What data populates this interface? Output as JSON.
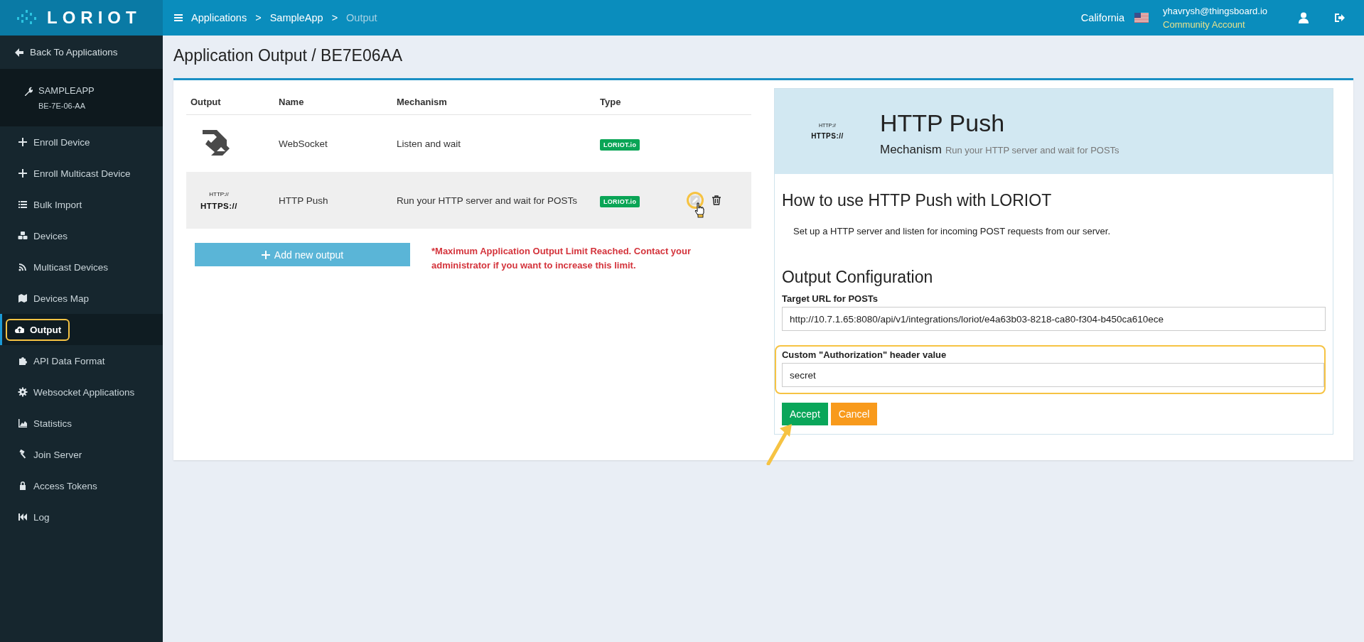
{
  "topbar": {
    "logo": "LORIOT",
    "breadcrumb": [
      {
        "kind": "link",
        "label": "Applications"
      },
      {
        "kind": "separator",
        "label": ">"
      },
      {
        "kind": "link",
        "label": "SampleApp"
      },
      {
        "kind": "separator",
        "label": ">"
      },
      {
        "kind": "current",
        "label": "Output"
      }
    ],
    "region": "California",
    "user": {
      "email": "yhavrysh@thingsboard.io",
      "account": "Community Account"
    }
  },
  "sidebar": {
    "back": "Back To Applications",
    "app": {
      "name": "SAMPLEAPP",
      "eui": "BE-7E-06-AA"
    },
    "items": [
      {
        "label": "Enroll Device",
        "selected": false,
        "highlighted": false
      },
      {
        "label": "Enroll Multicast Device",
        "selected": false,
        "highlighted": false
      },
      {
        "label": "Bulk Import",
        "selected": false,
        "highlighted": false
      },
      {
        "label": "Devices",
        "selected": false,
        "highlighted": false
      },
      {
        "label": "Multicast Devices",
        "selected": false,
        "highlighted": false
      },
      {
        "label": "Devices Map",
        "selected": false,
        "highlighted": false
      },
      {
        "label": "Output",
        "selected": true,
        "highlighted": true
      },
      {
        "label": "API Data Format",
        "selected": false,
        "highlighted": false
      },
      {
        "label": "Websocket Applications",
        "selected": false,
        "highlighted": false
      },
      {
        "label": "Statistics",
        "selected": false,
        "highlighted": false
      },
      {
        "label": "Join Server",
        "selected": false,
        "highlighted": false
      },
      {
        "label": "Access Tokens",
        "selected": false,
        "highlighted": false
      },
      {
        "label": "Log",
        "selected": false,
        "highlighted": false
      }
    ]
  },
  "page_title": "Application Output / BE7E06AA",
  "outputs": {
    "columns": [
      "Output",
      "Name",
      "Mechanism",
      "Type"
    ],
    "rows": [
      {
        "logo": {
          "kind": "websocket"
        },
        "name": "WebSocket",
        "mechanism": "Listen and wait",
        "type": "LORIOT.io",
        "selected": false
      },
      {
        "logo": {
          "kind": "https",
          "top": "HTTP://",
          "bottom": "HTTPS://"
        },
        "name": "HTTP Push",
        "mechanism": "Run your HTTP server and wait for POSTs",
        "type": "LORIOT.io",
        "selected": true,
        "actions": [
          {
            "kind": "edit",
            "highlighted": true
          },
          {
            "kind": "delete",
            "highlighted": false
          }
        ]
      }
    ],
    "add_button": "Add new output",
    "limit_warning": "*Maximum Application Output Limit Reached. Contact your administrator if you want to increase this limit."
  },
  "detail": {
    "logo_top": "HTTP://",
    "logo_bottom": "HTTPS://",
    "title": "HTTP Push",
    "mechanism_label": "Mechanism",
    "mechanism": "Run your HTTP server and wait for POSTs",
    "howto_title": "How to use HTTP Push with LORIOT",
    "howto_text": "Set up a HTTP server and listen for incoming POST requests from our server.",
    "config_title": "Output Configuration",
    "fields": [
      {
        "label": "Target URL for POSTs",
        "value": "http://10.7.1.65:8080/api/v1/integrations/loriot/e4a63b03-8218-ca80-f304-b450ca610ece",
        "highlighted": false
      },
      {
        "label": "Custom \"Authorization\" header value",
        "value": "secret",
        "highlighted": true
      }
    ],
    "buttons": [
      {
        "label": "Accept",
        "kind": "primary",
        "pointed": true
      },
      {
        "label": "Cancel",
        "kind": "warning",
        "pointed": false
      }
    ]
  }
}
